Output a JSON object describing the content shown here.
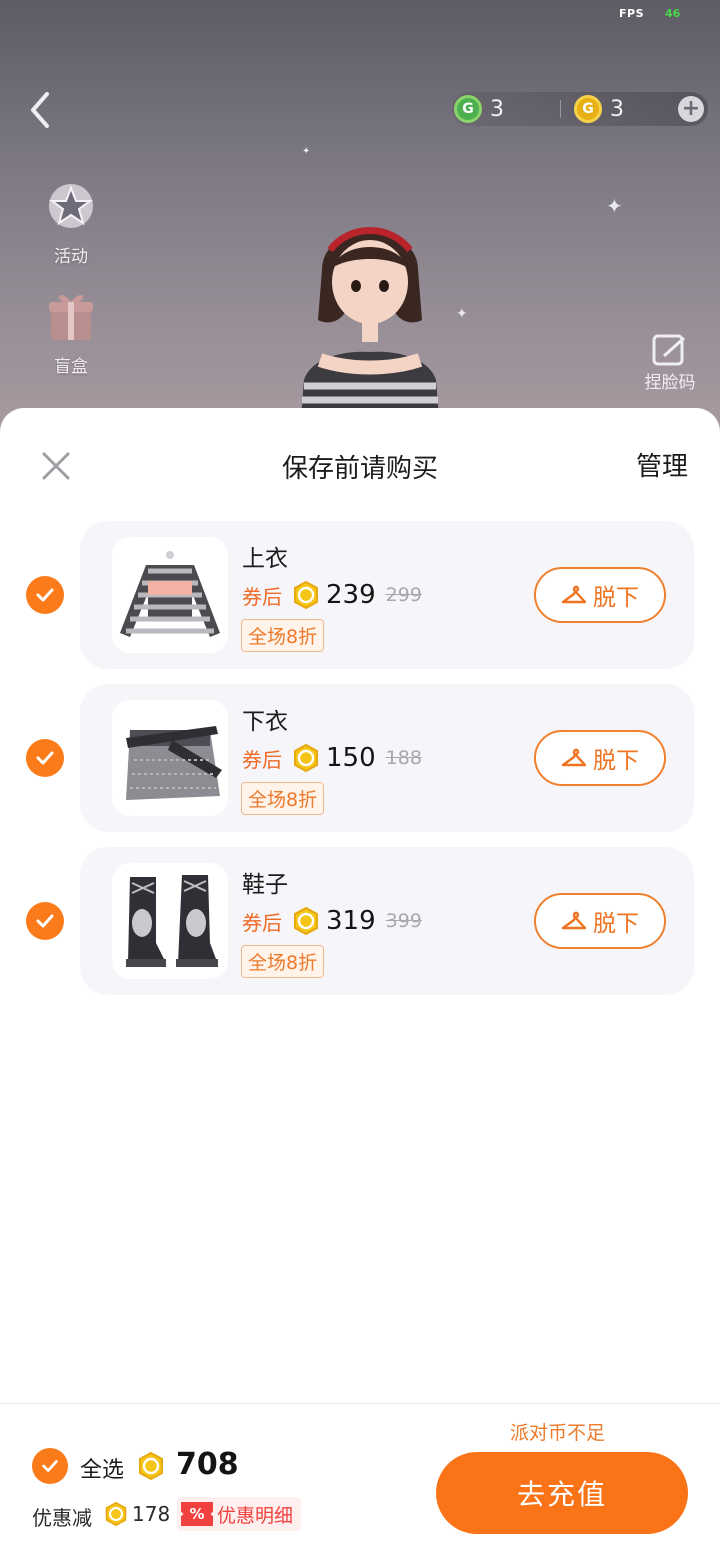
{
  "status": {
    "fps_label": "FPS",
    "fps_value": "46"
  },
  "top_bar": {
    "green_coin_value": "3",
    "gold_coin_value": "3",
    "add_symbol": "+"
  },
  "side_menu": {
    "activity_label": "活动",
    "blindbox_label": "盲盒"
  },
  "face_code_label": "捏脸码",
  "sheet": {
    "title": "保存前请购买",
    "manage_label": "管理"
  },
  "items": [
    {
      "name": "上衣",
      "price_prefix": "券后",
      "price": "239",
      "original_price": "299",
      "discount_tag": "全场8折",
      "action_label": "脱下"
    },
    {
      "name": "下衣",
      "price_prefix": "券后",
      "price": "150",
      "original_price": "188",
      "discount_tag": "全场8折",
      "action_label": "脱下"
    },
    {
      "name": "鞋子",
      "price_prefix": "券后",
      "price": "319",
      "original_price": "399",
      "discount_tag": "全场8折",
      "action_label": "脱下"
    }
  ],
  "footer": {
    "select_all_label": "全选",
    "total": "708",
    "discount_label": "优惠减",
    "discount_value": "178",
    "discount_badge": "%",
    "discount_detail_label": "优惠明细",
    "insufficient_text": "派对币不足",
    "recharge_label": "去充值"
  },
  "colors": {
    "accent_orange": "#fa7316",
    "check_orange": "#fb7a1a",
    "coin_gold": "#f5c518",
    "coin_green": "#4caf50",
    "discount_red": "#f0413e",
    "sheet_bg": "#ffffff",
    "card_bg": "#f6f5f9"
  },
  "icons": {
    "back": "chevron-left-icon",
    "close": "close-icon",
    "check": "check-icon",
    "coin": "coin-icon",
    "hanger": "hanger-icon",
    "plus": "plus-icon"
  }
}
